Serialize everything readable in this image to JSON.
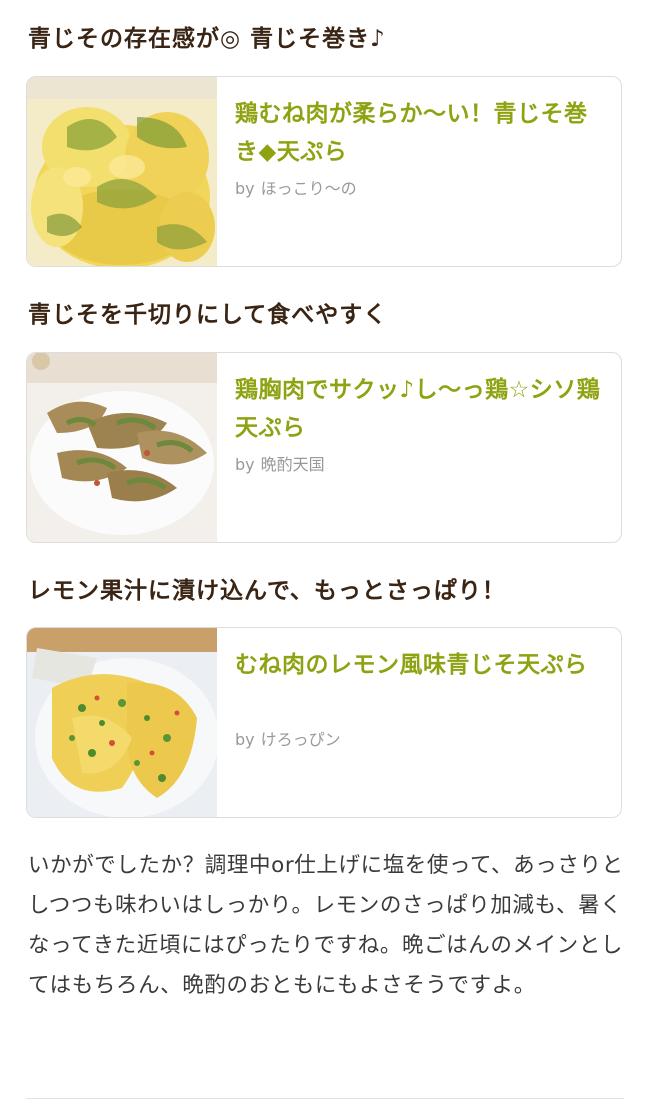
{
  "sections": [
    {
      "heading": "青じその存在感が◎ 青じそ巻き♪",
      "card": {
        "title": "鶏むね肉が柔らか〜い！青じそ巻き◆天ぷら",
        "by": "by",
        "author": "ほっこり〜の"
      }
    },
    {
      "heading": "青じそを千切りにして食べやすく",
      "card": {
        "title": "鶏胸肉でサクッ♪し〜っ鶏☆シソ鶏天ぷら",
        "by": "by",
        "author": "晩酌天国"
      }
    },
    {
      "heading": "レモン果汁に漬け込んで、もっとさっぱり！",
      "card": {
        "title": "むね肉のレモン風味青じそ天ぷら",
        "by": "by",
        "author": "けろっぴン"
      }
    }
  ],
  "closing_text": "いかがでしたか？調理中or仕上げに塩を使って、あっさりとしつつも味わいはしっかり。レモンのさっぱり加減も、暑くなってきた近頃にはぴったりですね。晩ごはんのメインとしてはもちろん、晩酌のおともにもよさそうですよ。",
  "colors": {
    "heading": "#3a2414",
    "card_title": "#8fa312",
    "author": "#999999",
    "card_border": "#dddddd"
  }
}
